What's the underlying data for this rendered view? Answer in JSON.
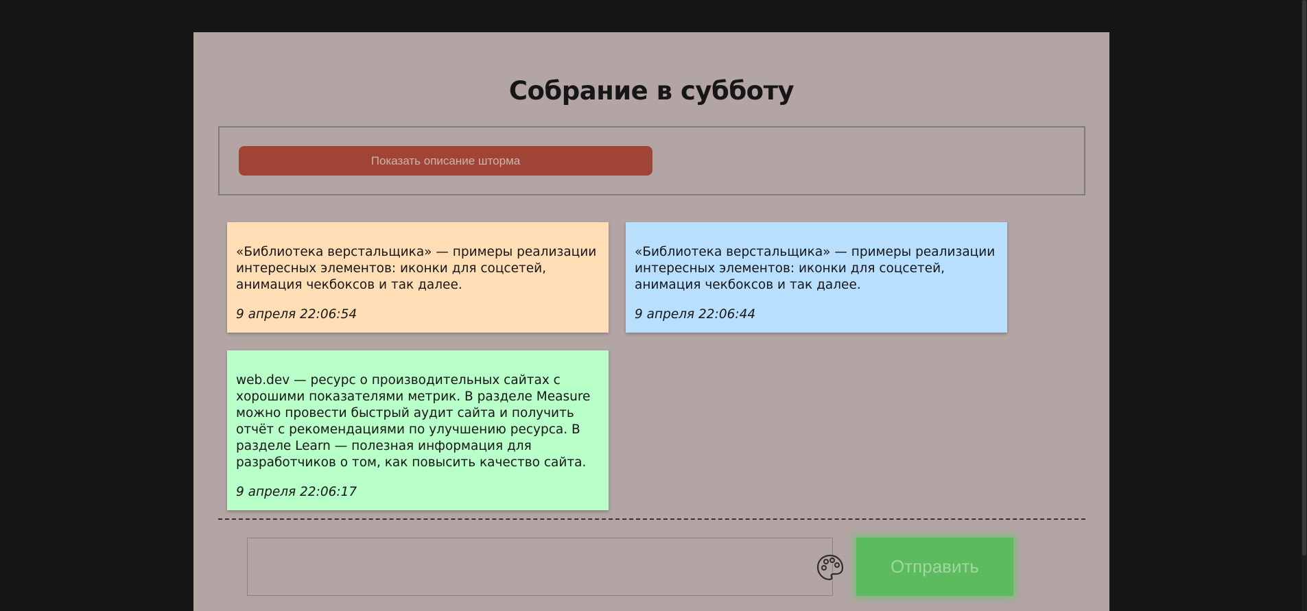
{
  "page": {
    "title": "Собрание в субботу"
  },
  "storm": {
    "button_label": "Показать описание шторма"
  },
  "cards": [
    {
      "text": "«Библиотека верстальщика» — примеры реализации интересных элементов: иконки для соцсетей, анимация чекбоксов и так далее.",
      "time": "9 апреля 22:06:54",
      "color": "#ffdeb6"
    },
    {
      "text": "«Библиотека верстальщика» — примеры реализации интересных элементов: иконки для соцсетей, анимация чекбоксов и так далее.",
      "time": "9 апреля 22:06:44",
      "color": "#b8dffe"
    },
    {
      "text": "web.dev — ресурс о производительных сайтах с хорошими показателями метрик. В разделе Measure можно провести быстрый аудит сайта и получить отчёт с рекомендациями по улучшению ресурса. В разделе Learn — полезная информация для разработчиков о том, как повысить качество сайта.",
      "time": "9 апреля 22:06:17",
      "color": "#b7fec9"
    }
  ],
  "compose": {
    "value": "",
    "palette_icon": "palette-icon",
    "send_label": "Отправить",
    "send_color": "#5cbb5e"
  },
  "colors": {
    "background": "#161616",
    "page": "#b2a5a4",
    "storm_button": "#a04535"
  }
}
